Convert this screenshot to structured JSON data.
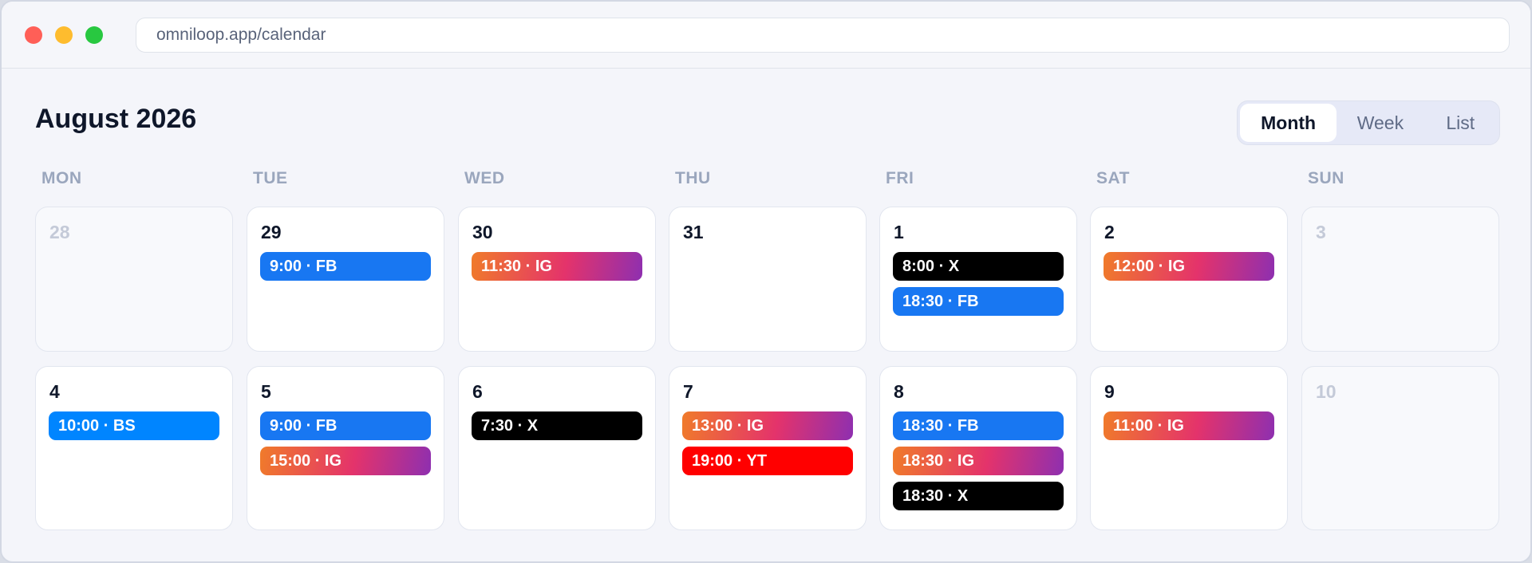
{
  "browser": {
    "url": "omniloop.app/calendar"
  },
  "calendar": {
    "title": "August 2026",
    "views": [
      "Month",
      "Week",
      "List"
    ],
    "active_view": "Month",
    "weekdays": [
      "MON",
      "TUE",
      "WED",
      "THU",
      "FRI",
      "SAT",
      "SUN"
    ],
    "weeks": [
      [
        {
          "day": "28",
          "muted": true,
          "events": []
        },
        {
          "day": "29",
          "muted": false,
          "events": [
            {
              "label": "9:00 · FB",
              "platform": "fb"
            }
          ]
        },
        {
          "day": "30",
          "muted": false,
          "events": [
            {
              "label": "11:30 · IG",
              "platform": "ig"
            }
          ]
        },
        {
          "day": "31",
          "muted": false,
          "events": []
        },
        {
          "day": "1",
          "muted": false,
          "events": [
            {
              "label": "8:00 · X",
              "platform": "x"
            },
            {
              "label": "18:30 · FB",
              "platform": "fb"
            }
          ]
        },
        {
          "day": "2",
          "muted": false,
          "events": [
            {
              "label": "12:00 · IG",
              "platform": "ig"
            }
          ]
        },
        {
          "day": "3",
          "muted": true,
          "events": []
        }
      ],
      [
        {
          "day": "4",
          "muted": false,
          "events": [
            {
              "label": "10:00 · BS",
              "platform": "bs"
            }
          ]
        },
        {
          "day": "5",
          "muted": false,
          "events": [
            {
              "label": "9:00 · FB",
              "platform": "fb"
            },
            {
              "label": "15:00 · IG",
              "platform": "ig"
            }
          ]
        },
        {
          "day": "6",
          "muted": false,
          "events": [
            {
              "label": "7:30 · X",
              "platform": "x"
            }
          ]
        },
        {
          "day": "7",
          "muted": false,
          "events": [
            {
              "label": "13:00 · IG",
              "platform": "ig"
            },
            {
              "label": "19:00 · YT",
              "platform": "yt"
            }
          ]
        },
        {
          "day": "8",
          "muted": false,
          "events": [
            {
              "label": "18:30 · FB",
              "platform": "fb"
            },
            {
              "label": "18:30 · IG",
              "platform": "ig"
            },
            {
              "label": "18:30 · X",
              "platform": "x"
            }
          ]
        },
        {
          "day": "9",
          "muted": false,
          "events": [
            {
              "label": "11:00 · IG",
              "platform": "ig"
            }
          ]
        },
        {
          "day": "10",
          "muted": true,
          "events": []
        }
      ]
    ]
  },
  "colors": {
    "fb": "#1877f2",
    "bs": "#0085ff",
    "x": "#000000",
    "yt": "#ff0000",
    "ig_start": "#f07b2a",
    "ig_mid": "#e4336b",
    "ig_end": "#8e2fb0",
    "window_traffic_red": "#ff5f57",
    "window_traffic_yellow": "#febc2e",
    "window_traffic_green": "#28c840"
  }
}
